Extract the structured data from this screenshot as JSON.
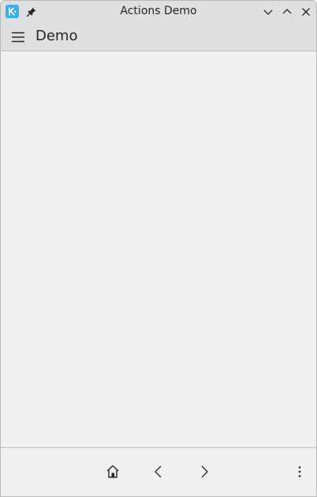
{
  "window": {
    "title": "Actions Demo"
  },
  "header": {
    "title": "Demo"
  },
  "icons": {
    "app": "kde-app-icon",
    "pin": "pin-icon",
    "minimize": "chevron-down-icon",
    "maximize": "chevron-up-icon",
    "close": "close-icon",
    "menu": "hamburger-menu-icon",
    "home": "home-icon",
    "back": "chevron-left-icon",
    "forward": "chevron-right-icon",
    "more": "overflow-menu-icon"
  },
  "colors": {
    "accent": "#3daee9",
    "titlebar": "#dedfe0",
    "background": "#eff0f1",
    "text": "#232629"
  }
}
